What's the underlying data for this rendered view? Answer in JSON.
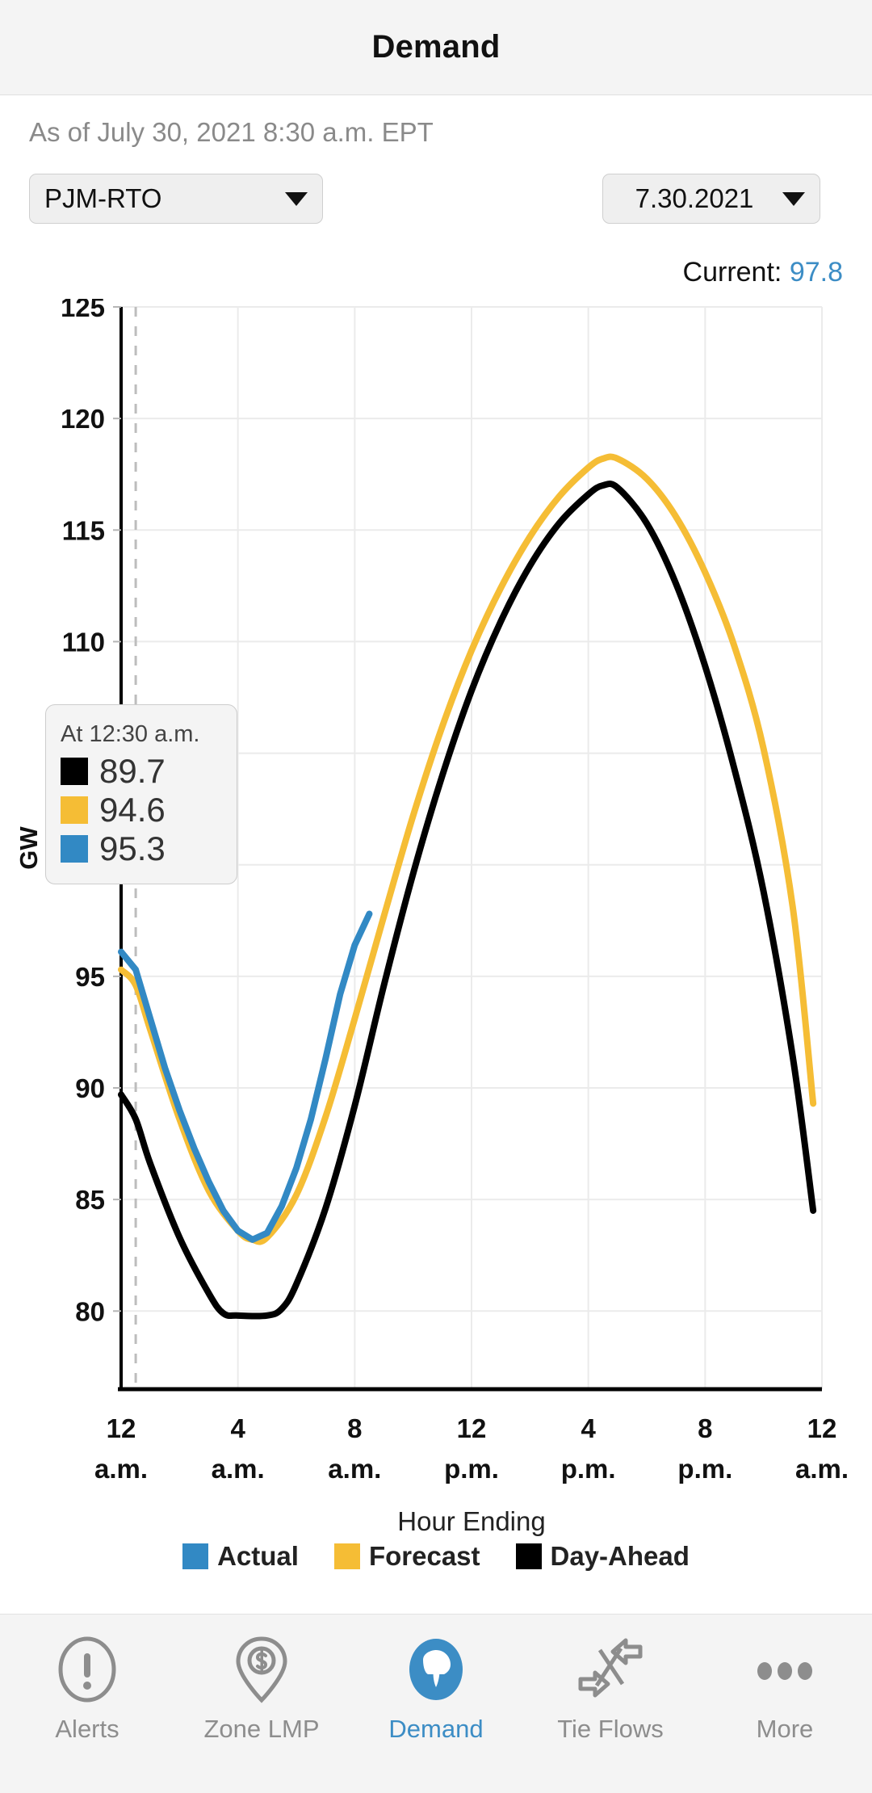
{
  "appbar": {
    "title": "Demand"
  },
  "asof": {
    "text": "As of July 30, 2021 8:30 a.m. EPT"
  },
  "controls": {
    "region": {
      "value": "PJM-RTO",
      "caret_icon": "chevron-down-icon"
    },
    "date": {
      "value": "7.30.2021",
      "caret_icon": "chevron-down-icon"
    }
  },
  "current": {
    "label": "Current:",
    "value": "97.8",
    "color": "#3c8dc5"
  },
  "tooltip": {
    "time_label": "At 12:30 a.m.",
    "rows": [
      {
        "series": "Day-Ahead",
        "color": "#000000",
        "value": "89.7"
      },
      {
        "series": "Forecast",
        "color": "#f5bd35",
        "value": "94.6"
      },
      {
        "series": "Actual",
        "color": "#3289c4",
        "value": "95.3"
      }
    ]
  },
  "legend": {
    "items": [
      {
        "label": "Actual",
        "color": "#3289c4"
      },
      {
        "label": "Forecast",
        "color": "#f5bd35"
      },
      {
        "label": "Day-Ahead",
        "color": "#000000"
      }
    ]
  },
  "bottom_nav": {
    "items": [
      {
        "label": "Alerts",
        "icon": "alert-exclamation-circle-icon",
        "active": false
      },
      {
        "label": "Zone LMP",
        "icon": "map-pin-dollar-icon",
        "active": false
      },
      {
        "label": "Demand",
        "icon": "gauge-circle-icon",
        "active": true
      },
      {
        "label": "Tie Flows",
        "icon": "two-way-arrows-icon",
        "active": false
      },
      {
        "label": "More",
        "icon": "three-dots-icon",
        "active": false
      }
    ]
  },
  "chart_data": {
    "type": "line",
    "title": "",
    "xlabel": "Hour Ending",
    "ylabel": "GW",
    "ylim": [
      76.5,
      125
    ],
    "yticks": [
      80,
      85,
      90,
      95,
      100,
      105,
      110,
      115,
      120,
      125
    ],
    "ytick_labels_visible": [
      "125",
      "120",
      "115",
      "110",
      "95",
      "90",
      "85",
      "80"
    ],
    "xlim": [
      0,
      24
    ],
    "xticks": [
      0,
      4,
      8,
      12,
      16,
      20,
      24
    ],
    "xtick_labels": [
      [
        "12",
        "a.m."
      ],
      [
        "4",
        "a.m."
      ],
      [
        "8",
        "a.m."
      ],
      [
        "12",
        "p.m."
      ],
      [
        "4",
        "p.m."
      ],
      [
        "8",
        "p.m."
      ],
      [
        "12",
        "a.m."
      ]
    ],
    "grid": true,
    "legend_position": "bottom",
    "marker_line_hour": 0.5,
    "hover_hour": 0.5,
    "series": [
      {
        "name": "Day-Ahead",
        "color": "#000000",
        "x": [
          0,
          0.5,
          1,
          2,
          3,
          3.5,
          4,
          5,
          5.5,
          6,
          7,
          8,
          9,
          10,
          11,
          12,
          13,
          14,
          15,
          16,
          16.5,
          17,
          18,
          19,
          20,
          21,
          22,
          23,
          23.7
        ],
        "values": [
          89.7,
          88.6,
          86.6,
          83.3,
          80.8,
          79.9,
          79.8,
          79.8,
          80.1,
          81.2,
          84.6,
          89.2,
          94.6,
          99.6,
          104.0,
          107.8,
          110.9,
          113.4,
          115.3,
          116.6,
          117.0,
          116.9,
          115.3,
          112.6,
          108.9,
          104.3,
          98.8,
          91.4,
          84.5
        ]
      },
      {
        "name": "Forecast",
        "color": "#f5bd35",
        "x": [
          0,
          0.5,
          1,
          2,
          3,
          4,
          4.5,
          5,
          6,
          7,
          8,
          9,
          10,
          11,
          12,
          13,
          14,
          15,
          16,
          16.5,
          17,
          18,
          19,
          20,
          21,
          22,
          23,
          23.7
        ],
        "values": [
          95.3,
          94.6,
          92.6,
          88.6,
          85.4,
          83.6,
          83.2,
          83.3,
          85.2,
          88.7,
          93.1,
          97.7,
          102.2,
          106.2,
          109.6,
          112.4,
          114.7,
          116.5,
          117.8,
          118.2,
          118.2,
          117.3,
          115.6,
          113.1,
          109.8,
          105.2,
          98.1,
          89.3
        ]
      },
      {
        "name": "Actual",
        "color": "#3289c4",
        "x": [
          0,
          0.5,
          1,
          1.5,
          2,
          2.5,
          3,
          3.5,
          4,
          4.5,
          5,
          5.5,
          6,
          6.5,
          7,
          7.5,
          8,
          8.5
        ],
        "values": [
          96.1,
          95.3,
          93.1,
          90.9,
          89.0,
          87.3,
          85.8,
          84.5,
          83.6,
          83.2,
          83.5,
          84.7,
          86.4,
          88.6,
          91.3,
          94.2,
          96.4,
          97.8
        ]
      }
    ]
  }
}
